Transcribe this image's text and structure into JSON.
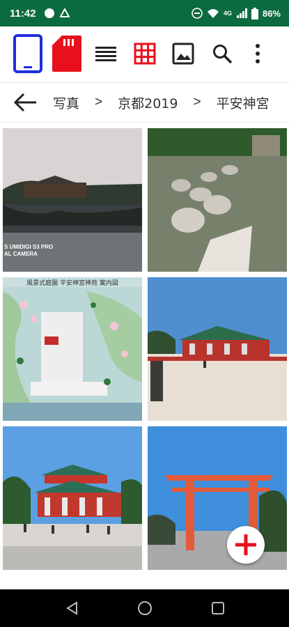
{
  "status_bar": {
    "time": "11:42",
    "network": "4G",
    "battery": "86%"
  },
  "toolbar": {
    "icons": [
      "phone-storage-icon",
      "sd-card-icon",
      "list-view-icon",
      "grid-view-icon",
      "image-icon",
      "search-icon",
      "more-vert-icon"
    ],
    "accent_blue": "#1e2fdc",
    "accent_red": "#e8101c"
  },
  "breadcrumb": {
    "items": [
      "写真",
      "京都2019",
      "平安神宮"
    ],
    "separator": ">"
  },
  "photos": {
    "watermark": [
      "S UMIDIGI S3 PRO",
      "AL CAMERA"
    ],
    "map_title": "風景式庭園  平安神宮神苑  案内図"
  }
}
